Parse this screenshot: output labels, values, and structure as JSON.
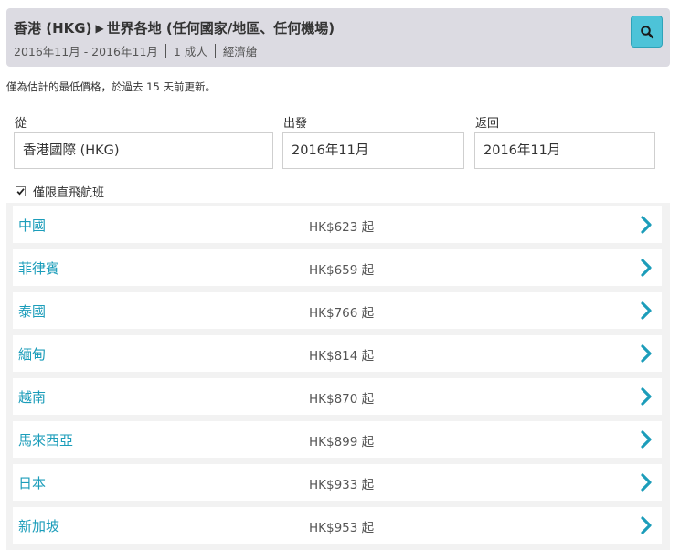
{
  "summary": {
    "origin": "香港 (HKG)",
    "destination": "世界各地 (任何國家/地區、任何機場)",
    "dates": "2016年11月 - 2016年11月",
    "passengers": "1 成人",
    "cabin": "經濟艙",
    "search_icon": "search-icon",
    "accent_color": "#4dc3d8"
  },
  "notice": "僅為估計的最低價格，於過去 15 天前更新。",
  "form": {
    "from": {
      "label": "從",
      "value": "香港國際 (HKG)"
    },
    "depart": {
      "label": "出發",
      "value": "2016年11月"
    },
    "return": {
      "label": "返回",
      "value": "2016年11月"
    },
    "direct_only": {
      "label": "僅限直飛航班",
      "checked": true
    }
  },
  "results": [
    {
      "country": "中國",
      "price": "HK$623 起"
    },
    {
      "country": "菲律賓",
      "price": "HK$659 起"
    },
    {
      "country": "泰國",
      "price": "HK$766 起"
    },
    {
      "country": "緬甸",
      "price": "HK$814 起"
    },
    {
      "country": "越南",
      "price": "HK$870 起"
    },
    {
      "country": "馬來西亞",
      "price": "HK$899 起"
    },
    {
      "country": "日本",
      "price": "HK$933 起"
    },
    {
      "country": "新加坡",
      "price": "HK$953 起"
    }
  ],
  "link_color": "#1c9dba"
}
